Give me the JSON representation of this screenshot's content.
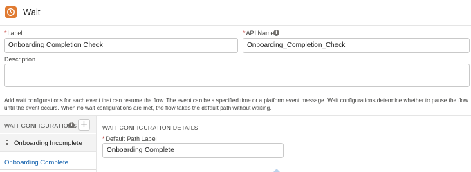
{
  "header": {
    "title": "Wait",
    "icon": "clock-icon",
    "icon_color": "#e07b32"
  },
  "fields": {
    "label": {
      "required_marker": "*",
      "label": "Label",
      "value": "Onboarding Completion Check"
    },
    "api_name": {
      "required_marker": "*",
      "label": "API Name",
      "value": "Onboarding_Completion_Check"
    },
    "description": {
      "label": "Description",
      "value": ""
    }
  },
  "help_text": "Add wait configurations for each event that can resume the flow. The event can be a specified time or a platform event message. Wait configurations determine whether to pause the flow until the event occurs. When no wait configurations are met, the flow takes the default path without waiting.",
  "wait_configurations": {
    "header": "WAIT CONFIGURATIONS",
    "add_label": "+",
    "items": [
      {
        "label": "Onboarding Incomplete"
      },
      {
        "label": "Onboarding Complete"
      }
    ]
  },
  "details": {
    "title": "WAIT CONFIGURATION DETAILS",
    "default_path": {
      "required_marker": "*",
      "label": "Default Path Label",
      "value": "Onboarding Complete"
    }
  },
  "colors": {
    "link": "#0b5cab",
    "required": "#c23934"
  }
}
